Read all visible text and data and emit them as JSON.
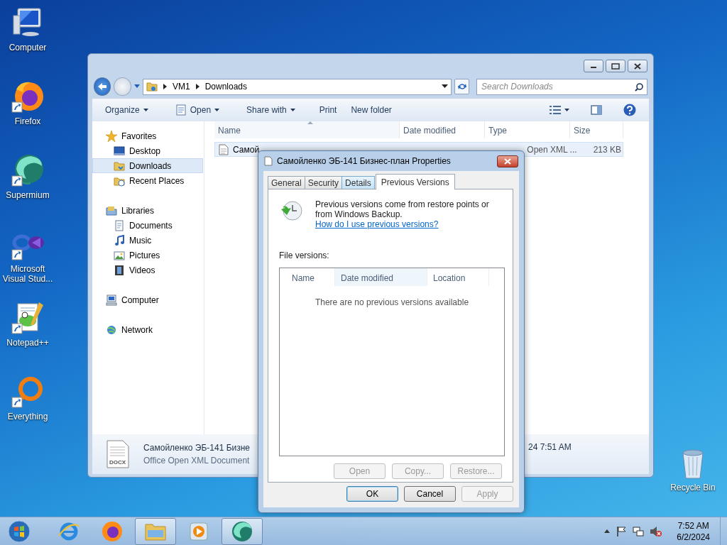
{
  "desktop_icons": [
    {
      "label": "Computer",
      "shortcut": false
    },
    {
      "label": "Firefox",
      "shortcut": true
    },
    {
      "label": "Supermium",
      "shortcut": true
    },
    {
      "label": "Microsoft Visual Stud...",
      "shortcut": true
    },
    {
      "label": "Notepad++",
      "shortcut": true
    },
    {
      "label": "Everything",
      "shortcut": true
    }
  ],
  "recycle_bin": {
    "label": "Recycle Bin"
  },
  "explorer": {
    "breadcrumb": [
      "VM1",
      "Downloads"
    ],
    "search": {
      "placeholder": "Search Downloads"
    },
    "toolbar": [
      {
        "label": "Organize",
        "dropdown": true
      },
      {
        "label": "Open",
        "dropdown": true
      },
      {
        "label": "Share with",
        "dropdown": true
      },
      {
        "label": "Print",
        "dropdown": false
      },
      {
        "label": "New folder",
        "dropdown": false
      }
    ],
    "sidebar": [
      {
        "label": "Favorites",
        "selected": false,
        "children": [
          {
            "label": "Desktop",
            "selected": false
          },
          {
            "label": "Downloads",
            "selected": true
          },
          {
            "label": "Recent Places",
            "selected": false
          }
        ]
      },
      {
        "label": "Libraries",
        "selected": false,
        "children": [
          {
            "label": "Documents",
            "selected": false
          },
          {
            "label": "Music",
            "selected": false
          },
          {
            "label": "Pictures",
            "selected": false
          },
          {
            "label": "Videos",
            "selected": false
          }
        ]
      },
      {
        "label": "Computer",
        "selected": false
      },
      {
        "label": "Network",
        "selected": false
      }
    ],
    "columns": [
      {
        "label": "Name",
        "sorted": true
      },
      {
        "label": "Date modified",
        "sorted": false
      },
      {
        "label": "Type",
        "sorted": false
      },
      {
        "label": "Size",
        "sorted": false
      }
    ],
    "files": [
      {
        "name": "Самой",
        "type": "Open XML ...",
        "size": "213 KB",
        "selected": true
      }
    ],
    "details": {
      "badge": "DOCX",
      "name": "Самойленко ЭБ-141 Бизне",
      "type": "Office Open XML Document",
      "date": "24 7:51 AM"
    }
  },
  "dialog": {
    "title": "Самойленко ЭБ-141 Бизнес-план Properties",
    "tabs": [
      {
        "label": "General",
        "selected": false,
        "hovered": false
      },
      {
        "label": "Security",
        "selected": false,
        "hovered": false
      },
      {
        "label": "Details",
        "selected": false,
        "hovered": true
      },
      {
        "label": "Previous Versions",
        "selected": true,
        "hovered": false
      }
    ],
    "info": "Previous versions come from restore points or from Windows Backup.",
    "link": "How do I use previous versions?",
    "list_label": "File versions:",
    "columns": [
      {
        "label": "Name",
        "sorted": false
      },
      {
        "label": "Date modified",
        "sorted": true
      },
      {
        "label": "Location",
        "sorted": false
      }
    ],
    "empty_message": "There are no previous versions available",
    "actions": [
      {
        "label": "Open",
        "disabled": true
      },
      {
        "label": "Copy...",
        "disabled": true
      },
      {
        "label": "Restore...",
        "disabled": true
      }
    ],
    "buttons": [
      {
        "label": "OK",
        "disabled": false,
        "default": true
      },
      {
        "label": "Cancel",
        "disabled": false,
        "default": false
      },
      {
        "label": "Apply",
        "disabled": true,
        "default": false
      }
    ]
  },
  "taskbar": {
    "items": [
      {
        "running": false
      },
      {
        "running": false
      },
      {
        "running": false
      },
      {
        "running": true
      },
      {
        "running": false
      },
      {
        "running": true
      }
    ],
    "time": "7:52 AM",
    "date": "6/2/2024"
  }
}
